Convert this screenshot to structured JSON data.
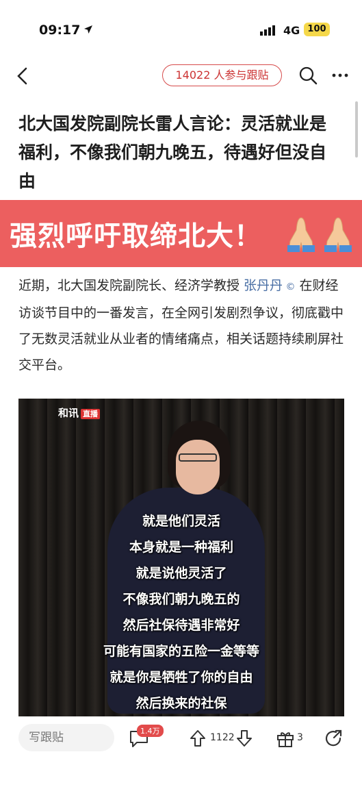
{
  "status": {
    "time": "09:17",
    "network": "4G",
    "battery": "100"
  },
  "nav": {
    "pill_label": "14022 人参与跟贴"
  },
  "article": {
    "title": "北大国发院副院长雷人言论：灵活就业是福利，不像我们朝九晚五，待遇好但没自由",
    "banner_text": "强烈呼吁取缔北大！",
    "para_before_link": "近期，北大国发院副院长、经济学教授 ",
    "link_text": "张丹丹",
    "para_after_link": " 在财经访谈节目中的一番发言，在全网引发剧烈争议，彻底戳中了无数灵活就业从业者的情绪痛点，相关话题持续刷屏社交平台。"
  },
  "video": {
    "logo": "和讯",
    "logo_tag": "直播",
    "subtitles": [
      "就是他们灵活",
      "本身就是一种福利",
      "就是说他灵活了",
      "不像我们朝九晚五的",
      "然后社保待遇非常好",
      "可能有国家的五险一金等等",
      "就是你是牺牲了你的自由",
      "然后换来的社保"
    ]
  },
  "bottom": {
    "reply_placeholder": "写跟贴",
    "comment_badge": "1.4万",
    "vote_count": "1122",
    "gift_count": "3"
  },
  "colors": {
    "banner": "#ec5f5f",
    "accent": "#d64a4a",
    "link": "#4a6fa5"
  }
}
